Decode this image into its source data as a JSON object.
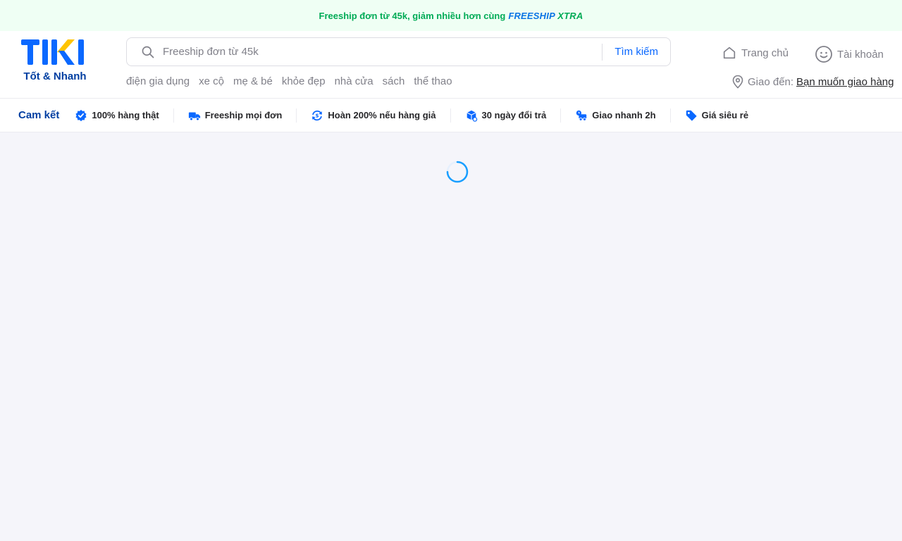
{
  "promo": {
    "text": "Freeship đơn từ 45k, giảm nhiều hơn cùng",
    "badge_a": "FREESHIP",
    "badge_b": "XTRA"
  },
  "logo": {
    "tagline": "Tốt & Nhanh",
    "brand_color": "#0a68ff",
    "accent_color": "#ffc400"
  },
  "search": {
    "placeholder": "Freeship đơn từ 45k",
    "button_label": "Tìm kiếm"
  },
  "quick_links": [
    "điện gia dụng",
    "xe cộ",
    "mẹ & bé",
    "khỏe đẹp",
    "nhà cửa",
    "sách",
    "thể thao"
  ],
  "nav": {
    "home_label": "Trang chủ",
    "account_label": "Tài khoản"
  },
  "delivery": {
    "label": "Giao đến:",
    "address": "Bạn muốn giao hàng"
  },
  "commitments": {
    "title": "Cam kết",
    "items": [
      {
        "label": "100% hàng thật",
        "icon": "verified-badge-icon"
      },
      {
        "label": "Freeship mọi đơn",
        "icon": "delivery-truck-icon"
      },
      {
        "label": "Hoàn 200% nếu hàng giả",
        "icon": "refund-icon"
      },
      {
        "label": "30 ngày đổi trả",
        "icon": "return-box-icon"
      },
      {
        "label": "Giao nhanh 2h",
        "icon": "fast-delivery-icon"
      },
      {
        "label": "Giá siêu rẻ",
        "icon": "price-tag-icon"
      }
    ]
  },
  "colors": {
    "primary": "#0a68ff",
    "promo_green": "#00ab56",
    "dark_blue": "#003ea1"
  }
}
